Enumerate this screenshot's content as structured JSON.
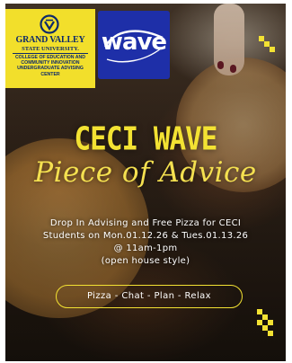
{
  "logos": {
    "gvsu": {
      "name_line1": "GRAND VALLEY",
      "name_line2": "STATE UNIVERSITY.",
      "college_line1": "COLLEGE OF EDUCATION AND",
      "college_line2": "COMMUNITY INNOVATION",
      "college_line3": "UNDERGRADUATE ADVISING",
      "college_line4": "CENTER",
      "colors": {
        "background": "#f2df2b",
        "text": "#0d2a6b"
      }
    },
    "wave": {
      "text": "wave",
      "colors": {
        "background": "#1e2fa8",
        "text": "#ffffff"
      }
    }
  },
  "poster": {
    "title": "CECI WAVE",
    "subtitle": "Piece of Advice",
    "details": [
      "Drop In Advising and Free Pizza for CECI",
      "Students on Mon.01.12.26 & Tues.01.13.26",
      "@ 11am-1pm",
      "(open house style)"
    ],
    "tagline": "Pizza - Chat - Plan - Relax",
    "colors": {
      "accent": "#f3e233",
      "body_text": "#ffffff"
    }
  },
  "icons": [
    "gvsu-logo-icon",
    "wave-logo-icon",
    "decorative-dots-icon"
  ]
}
